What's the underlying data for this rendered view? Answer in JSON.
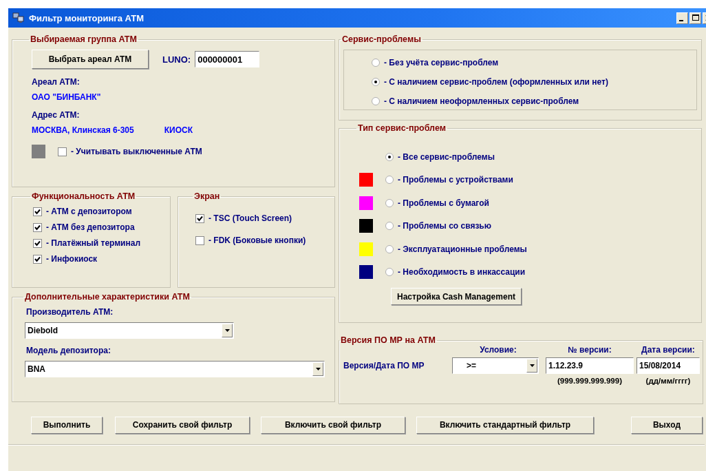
{
  "window": {
    "title": "Фильтр мониторинга АТМ"
  },
  "atm_group": {
    "title": "Выбираемая группа АТМ",
    "select_button": "Выбрать ареал АТМ",
    "luno_label": "LUNO:",
    "luno_value": "000000001",
    "area_label": "Ареал АТМ:",
    "area_value": "ОАО \"БИНБАНК\"",
    "address_label": "Адрес АТМ:",
    "address_value": "МОСКВА, Клинская 6-305",
    "address_type": "КИОСК",
    "include_disabled": {
      "label": "- Учитывать выключенные АТМ",
      "checked": false
    }
  },
  "functionality": {
    "title": "Функциональность АТМ",
    "items": [
      {
        "label": "- АТМ с депозитором",
        "checked": true
      },
      {
        "label": "- АТМ без депозитора",
        "checked": true
      },
      {
        "label": "- Платёжный терминал",
        "checked": true
      },
      {
        "label": "- Инфокиоск",
        "checked": true
      }
    ]
  },
  "screen": {
    "title": "Экран",
    "items": [
      {
        "label": "- TSC (Touch Screen)",
        "checked": true
      },
      {
        "label": "- FDK (Боковые кнопки)",
        "checked": false
      }
    ]
  },
  "extra": {
    "title": "Дополнительные характеристики АТМ",
    "manufacturer_label": "Производитель АТМ:",
    "manufacturer_value": "Diebold",
    "depositor_label": "Модель депозитора:",
    "depositor_value": "BNA"
  },
  "service_problems": {
    "title": "Сервис-проблемы",
    "options": [
      {
        "label": "- Без учёта сервис-проблем",
        "selected": false
      },
      {
        "label": "- С наличием сервис-проблем (оформленных или нет)",
        "selected": true
      },
      {
        "label": "- С наличием неоформленных сервис-проблем",
        "selected": false
      }
    ]
  },
  "problem_types": {
    "title": "Тип сервис-проблем",
    "options": [
      {
        "label": "- Все сервис-проблемы",
        "selected": true
      },
      {
        "label": "- Проблемы с устройствами",
        "selected": false,
        "color": "#ff0000"
      },
      {
        "label": "- Проблемы с бумагой",
        "selected": false,
        "color": "#ff00ff"
      },
      {
        "label": "- Проблемы со связью",
        "selected": false,
        "color": "#000000"
      },
      {
        "label": "- Эксплуатационные проблемы",
        "selected": false,
        "color": "#ffff00"
      },
      {
        "label": "- Необходимость в инкассации",
        "selected": false,
        "color": "#000080"
      }
    ],
    "cash_button": "Настройка Cash Management"
  },
  "version": {
    "title": "Версия ПО МР на АТМ",
    "condition_label": "Условие:",
    "number_label": "№ версии:",
    "date_label": "Дата версии:",
    "row_label": "Версия/Дата ПО МР",
    "condition_value": ">=",
    "number_value": "1.12.23.9",
    "date_value": "15/08/2014",
    "number_hint": "(999.999.999.999)",
    "date_hint": "(дд/мм/гггг)"
  },
  "buttons": [
    "Выполнить",
    "Сохранить свой фильтр",
    "Включить свой фильтр",
    "Включить стандартный фильтр",
    "Выход"
  ]
}
